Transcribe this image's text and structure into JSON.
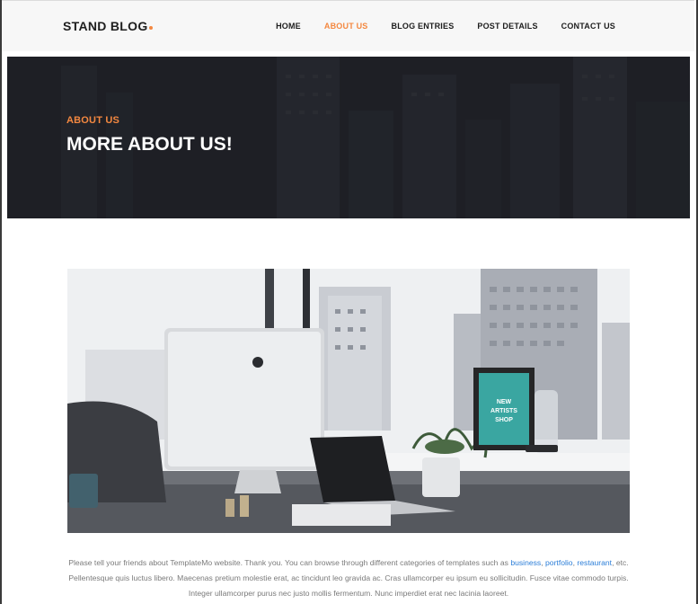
{
  "brand": {
    "name": "STAND BLOG",
    "accent_color": "#f48840"
  },
  "nav": {
    "items": [
      {
        "label": "HOME",
        "active": false
      },
      {
        "label": "ABOUT US",
        "active": true
      },
      {
        "label": "BLOG ENTRIES",
        "active": false
      },
      {
        "label": "POST DETAILS",
        "active": false
      },
      {
        "label": "CONTACT US",
        "active": false
      }
    ]
  },
  "hero": {
    "kicker": "ABOUT US",
    "title": "MORE ABOUT US!"
  },
  "photo": {
    "frame_sign": "NEW ARTISTS SHOP"
  },
  "content": {
    "line1_before": "Please tell your friends about TemplateMo website. Thank you. You can browse through different categories of templates such as ",
    "link_business": "business",
    "sep1": ", ",
    "link_portfolio": "portfolio",
    "sep2": ", ",
    "link_restaurant": "restaurant",
    "line1_after": ", etc.",
    "line2": "Pellentesque quis luctus libero. Maecenas pretium molestie erat, ac tincidunt leo gravida ac. Cras ullamcorper eu ipsum eu sollicitudin. Fusce vitae commodo turpis.",
    "line3": "Integer ullamcorper purus nec justo mollis fermentum. Nunc imperdiet erat nec lacinia laoreet."
  }
}
